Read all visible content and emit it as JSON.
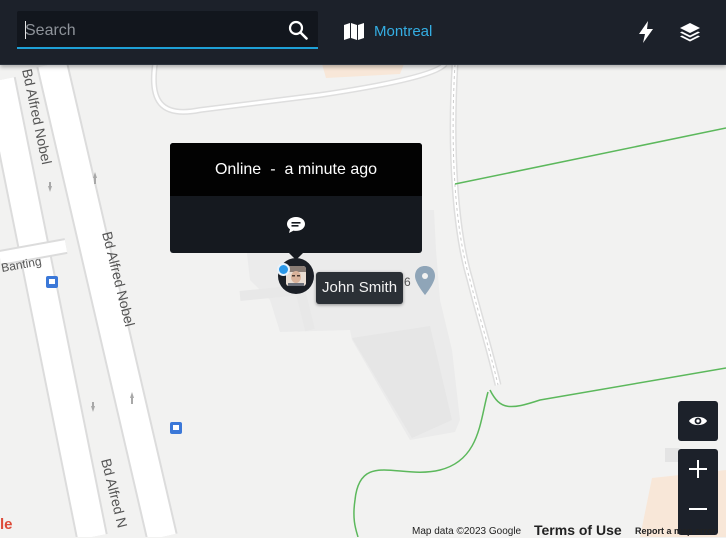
{
  "search": {
    "placeholder": "Search",
    "value": ""
  },
  "header": {
    "city": "Montreal"
  },
  "popup": {
    "status": "Online",
    "separator": "-",
    "last_seen": "a minute ago"
  },
  "user": {
    "name": "John Smith"
  },
  "map": {
    "street_labels": [
      "Bd Alfred Nobel",
      "Bd Alfred Nobel",
      "Bd Alfred N",
      "Banting"
    ],
    "number_fragment": "6"
  },
  "attribution": {
    "map_data": "Map data ©2023 Google",
    "terms": "Terms of Use",
    "report": "Report a map error",
    "google_fragment": "le"
  },
  "colors": {
    "accent": "#1ea0d6",
    "toolbar": "#1c212a",
    "status_online": "#2a97e8"
  },
  "icons": [
    "search-icon",
    "map-icon",
    "bolt-icon",
    "layers-icon",
    "chat-icon",
    "eye-icon",
    "plus-icon",
    "minus-icon"
  ]
}
